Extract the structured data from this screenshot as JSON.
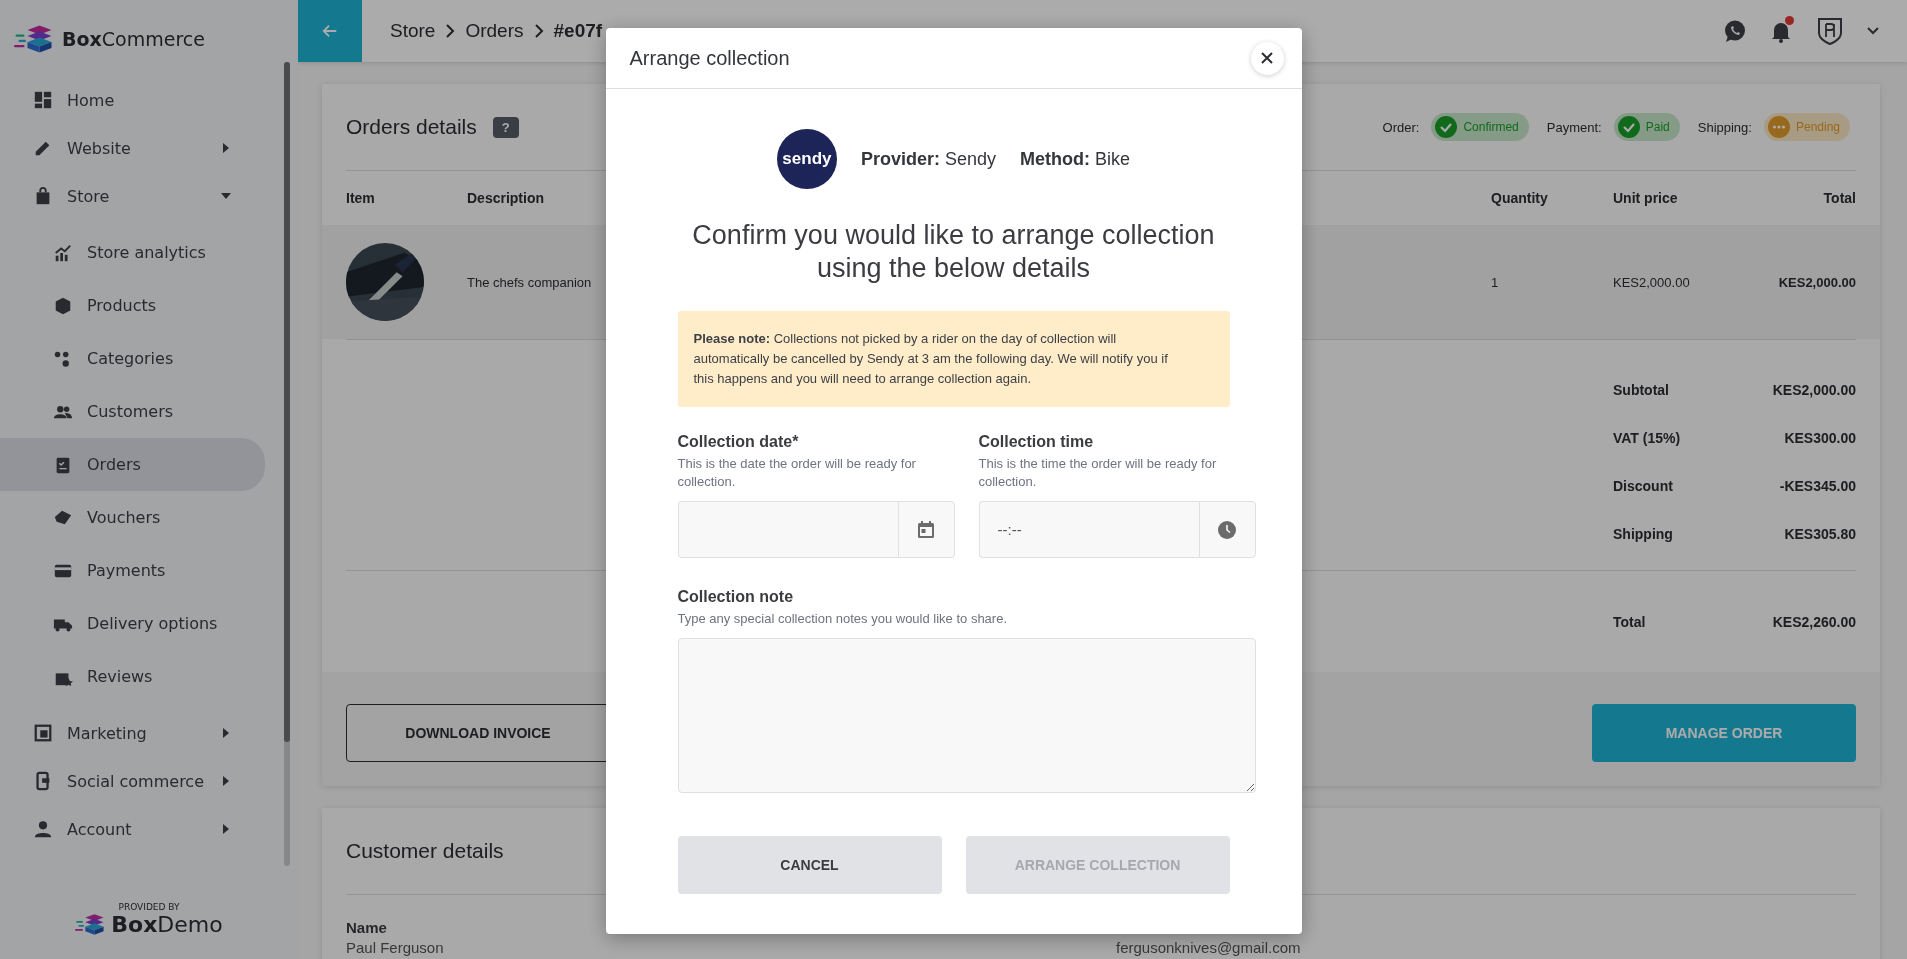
{
  "sidebar": {
    "brand_bold": "Box",
    "brand_rest": "Commerce",
    "items": [
      {
        "label": "Home",
        "kind": "link",
        "selected": false
      },
      {
        "label": "Website",
        "kind": "group",
        "expanded": false,
        "selected": false
      },
      {
        "label": "Store",
        "kind": "group",
        "expanded": true,
        "selected": false,
        "children": [
          {
            "label": "Store analytics",
            "selected": false
          },
          {
            "label": "Products",
            "selected": false
          },
          {
            "label": "Categories",
            "selected": false
          },
          {
            "label": "Customers",
            "selected": false
          },
          {
            "label": "Orders",
            "selected": true
          },
          {
            "label": "Vouchers",
            "selected": false
          },
          {
            "label": "Payments",
            "selected": false
          },
          {
            "label": "Delivery options",
            "selected": false
          },
          {
            "label": "Reviews",
            "selected": false
          }
        ]
      },
      {
        "label": "Marketing",
        "kind": "group",
        "expanded": false,
        "selected": false
      },
      {
        "label": "Social commerce",
        "kind": "group",
        "expanded": false,
        "selected": false
      },
      {
        "label": "Account",
        "kind": "group",
        "expanded": false,
        "selected": false
      }
    ],
    "footer": {
      "caption": "PROVIDED BY",
      "brand_bold": "Box",
      "brand_rest": "Demo"
    }
  },
  "header": {
    "breadcrumbs": [
      "Store",
      "Orders",
      "#e07f"
    ],
    "has_notification": true
  },
  "orders": {
    "title": "Orders details",
    "help": "?",
    "statuses": [
      {
        "label": "Order:",
        "value": "Confirmed",
        "kind": "success"
      },
      {
        "label": "Payment:",
        "value": "Paid",
        "kind": "success"
      },
      {
        "label": "Shipping:",
        "value": "Pending",
        "kind": "pending"
      }
    ],
    "columns": [
      "Item",
      "Description",
      "Quantity",
      "Unit price",
      "Total"
    ],
    "rows": [
      {
        "kind": "picture",
        "description": "The chefs companion",
        "quantity": "1",
        "unit_price": "KES2,000.00",
        "total": "KES2,000.00"
      }
    ],
    "summary": [
      {
        "label": "Subtotal",
        "value": "KES2,000.00"
      },
      {
        "label": "VAT (15%)",
        "value": "KES300.00"
      },
      {
        "label": "Discount",
        "value": "-KES345.00"
      },
      {
        "label": "Shipping",
        "value": "KES305.80"
      }
    ],
    "total": {
      "label": "Total",
      "value": "KES2,260.00"
    },
    "buttons": [
      {
        "label": "DOWNLOAD INVOICE",
        "kind": "outline"
      },
      {
        "label": "MANAGE ORDER",
        "kind": "primary"
      }
    ]
  },
  "customer": {
    "title": "Customer details",
    "name_label": "Name",
    "name": "Paul Ferguson",
    "email": "fergusonknives@gmail.com"
  },
  "modal": {
    "title": "Arrange collection",
    "logo_text": "sendy",
    "provider_label": "Provider:",
    "provider": "Sendy",
    "method_label": "Method:",
    "method": "Bike",
    "heading": "Confirm you would like to arrange collection using the below details",
    "note": "**Please note:** Collections not picked by a rider on the day of collection will automatically be cancelled by Sendy at 3 am the following day. We will notify you if this happens and you will need to arrange collection again.",
    "fields": [
      {
        "kind": "date",
        "label": "Collection date*",
        "hint": "This is the date the order will be ready for collection."
      },
      {
        "kind": "time",
        "label": "Collection time",
        "hint": "This is the time the order will be ready for collection.",
        "placeholder": "--:--"
      },
      {
        "kind": "textarea",
        "label": "Collection note",
        "hint": "Type any special collection notes you would like to share."
      }
    ],
    "buttons": [
      {
        "label": "CANCEL",
        "disabled": false
      },
      {
        "label": "ARRANGE COLLECTION",
        "disabled": true
      }
    ]
  }
}
